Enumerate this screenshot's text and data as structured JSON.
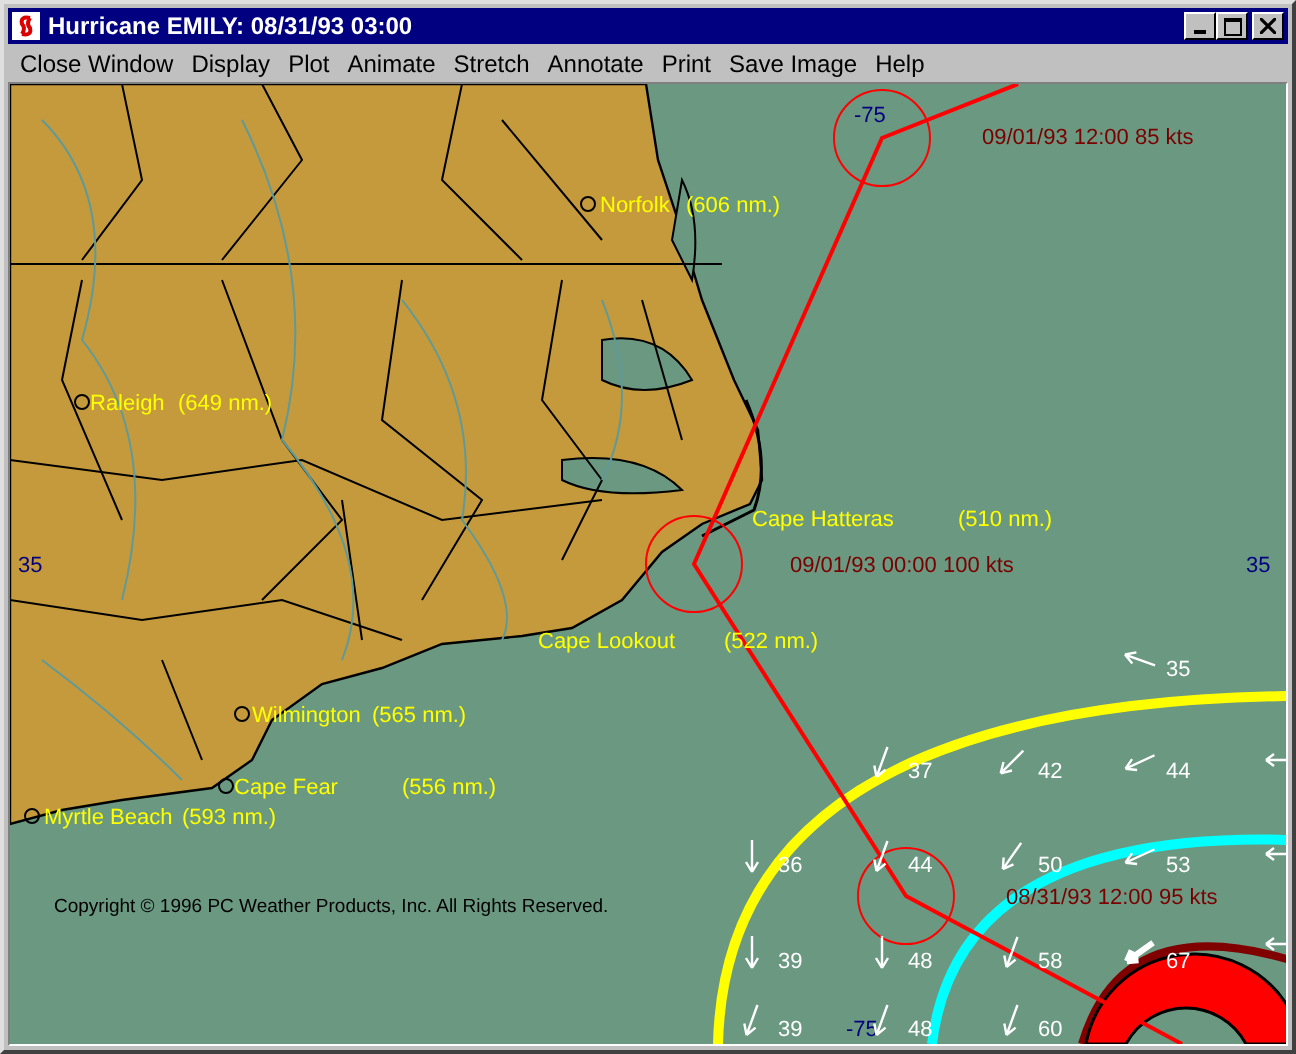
{
  "window": {
    "title": "Hurricane EMILY: 08/31/93 03:00"
  },
  "menu": [
    "Close Window",
    "Display",
    "Plot",
    "Animate",
    "Stretch",
    "Annotate",
    "Print",
    "Save Image",
    "Help"
  ],
  "map": {
    "places": [
      {
        "name": "Norfolk",
        "distance": "(606 nm.)"
      },
      {
        "name": "Raleigh",
        "distance": "(649 nm.)"
      },
      {
        "name": "Cape Hatteras",
        "distance": "(510 nm.)"
      },
      {
        "name": "Cape Lookout",
        "distance": "(522 nm.)"
      },
      {
        "name": "Wilmington",
        "distance": "(565 nm.)"
      },
      {
        "name": "Cape Fear",
        "distance": "(556 nm.)"
      },
      {
        "name": "Myrtle Beach",
        "distance": "(593 nm.)"
      }
    ],
    "track_points": [
      {
        "label": "09/01/93  12:00 85 kts"
      },
      {
        "label": "09/01/93  00:00 100 kts"
      },
      {
        "label": "08/31/93  12:00 95 kts"
      }
    ],
    "grid_labels": [
      "-75",
      "35",
      "35",
      "-75"
    ],
    "wind_speeds": [
      "35",
      "37",
      "42",
      "44",
      "36",
      "44",
      "50",
      "53",
      "39",
      "48",
      "58",
      "67",
      "39",
      "48",
      "60"
    ],
    "copyright": "Copyright © 1996 PC Weather Products, Inc. All Rights Reserved."
  }
}
